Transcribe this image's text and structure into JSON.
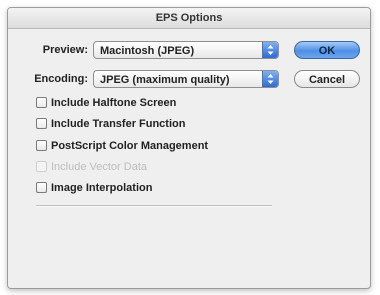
{
  "window": {
    "title": "EPS Options"
  },
  "preview": {
    "label": "Preview:",
    "value": "Macintosh (JPEG)"
  },
  "encoding": {
    "label": "Encoding:",
    "value": "JPEG (maximum quality)"
  },
  "buttons": {
    "ok": "OK",
    "cancel": "Cancel"
  },
  "options": [
    {
      "label": "Include Halftone Screen",
      "checked": false,
      "enabled": true
    },
    {
      "label": "Include Transfer Function",
      "checked": false,
      "enabled": true
    },
    {
      "label": "PostScript Color Management",
      "checked": false,
      "enabled": true
    },
    {
      "label": "Include Vector Data",
      "checked": false,
      "enabled": false
    },
    {
      "label": "Image Interpolation",
      "checked": false,
      "enabled": true
    }
  ],
  "colors": {
    "default_button": "#4f8fe6",
    "dialog_background": "#efefef"
  }
}
